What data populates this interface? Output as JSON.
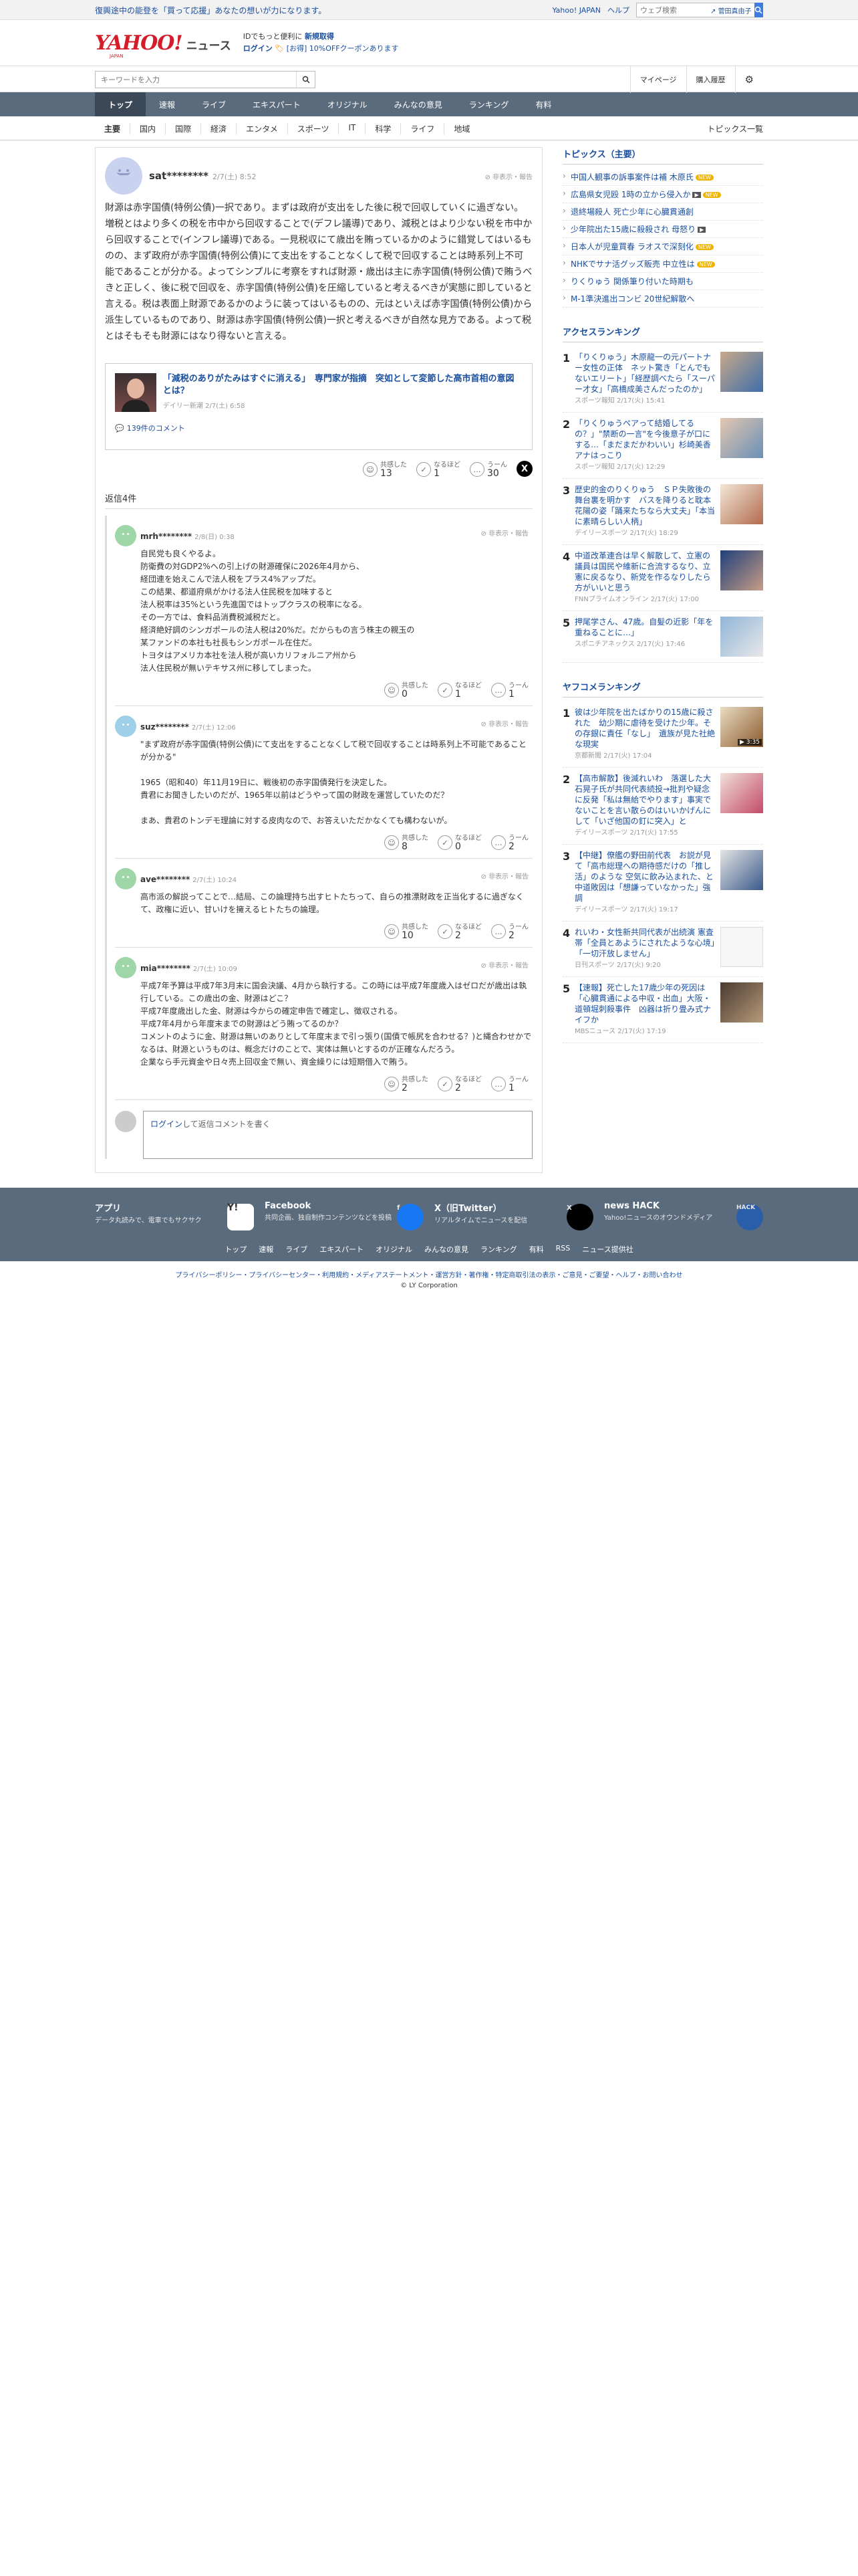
{
  "topbar": {
    "promo": "復興途中の能登を「買って応援」あなたの想いが力になります。",
    "yahoo_japan": "Yahoo! JAPAN",
    "help": "ヘルプ",
    "search_placeholder": "ウェブ検索",
    "trend": "菅田真由子"
  },
  "header": {
    "logo": "YAHOO!",
    "logo_sub": "JAPAN",
    "news": "ニュース",
    "promo_line1": "IDでもっと便利に",
    "promo_line1_b": "新規取得",
    "login": "ログイン",
    "promo_line2": "[お得] 10%OFFクーポンあります"
  },
  "searchbar": {
    "placeholder": "キーワードを入力",
    "mypage": "マイページ",
    "history": "購入履歴"
  },
  "mainnav": [
    "トップ",
    "速報",
    "ライブ",
    "エキスパート",
    "オリジナル",
    "みんなの意見",
    "ランキング",
    "有料"
  ],
  "subnav": {
    "items": [
      "主要",
      "国内",
      "国際",
      "経済",
      "エンタメ",
      "スポーツ",
      "IT",
      "科学",
      "ライフ",
      "地域"
    ],
    "all": "トピックス一覧"
  },
  "comment": {
    "user": "sat********",
    "time": "2/7(土) 8:52",
    "hide": "非表示・報告",
    "body": "財源は赤字国債(特例公債)一択であり。まずは政府が支出をした後に税で回収していくに過ぎない。増税とはより多くの税を市中から回収することで(デフレ議導)であり、減税とはより少ない税を市中から回収することで(インフレ議導)である。一見税収にて歳出を賄っているかのように錯覚してはいるものの、まず政府が赤字国債(特例公債)にて支出をすることなくして税で回収することは時系列上不可能であることが分かる。よってシンプルに考察をすれば財源・歳出は主に赤字国債(特例公債)で賄うべきと正しく、後に税で回収を、赤字国債(特例公債)を圧縮していると考えるべきが実態に即していると言える。税は表面上財源であるかのように装ってはいるものの、元はといえば赤字国債(特例公債)から派生しているものであり、財源は赤字国債(特例公債)一択と考えるべきが自然な見方である。よって税とはそもそも財源にはなり得ないと言える。",
    "article_title": "「減税のありがたみはすぐに消える」　専門家が指摘　突如として変節した高市首相の意図とは？",
    "article_src": "デイリー新潮 2/7(土) 6:58",
    "article_comments": "139件のコメント",
    "reacts": {
      "empathy": "共感した",
      "empathy_n": "13",
      "naruhodo": "なるほど",
      "naruhodo_n": "1",
      "uun": "うーん",
      "uun_n": "30"
    },
    "x_label": "X"
  },
  "replies_header": "返信4件",
  "replies": [
    {
      "user": "mrh********",
      "time": "2/8(日) 0:38",
      "color": "green",
      "body": "自民党も良くやるよ。\n防衛費の対GDP2%への引上げの財源確保に2026年4月から、\n経団連を始えこんで法人税をプラス4%アップだ。\nこの結果、都道府県がかける法人住民税を加味すると\n法人税率は35%という先進国ではトップクラスの税率になる。\nその一方では、食料品消費税減税だと。\n経済絶好調のシンガポールの法人税は20%だ。だからもの言う株主の親玉の\n某ファンドの本社も社長もシンガポール在住だ。\nトヨタはアメリカ本社を法人税が高いカリフォルニア州から\n法人住民税が無いテキサス州に移してしまった。",
      "r1": "0",
      "r2": "1",
      "r3": "1"
    },
    {
      "user": "suz********",
      "time": "2/7(土) 12:06",
      "color": "blue",
      "body": "\"まず政府が赤字国債(特例公債)にて支出をすることなくして税で回収することは時系列上不可能であることが分かる\"\n\n1965（昭和40）年11月19日に、戦後初の赤字国債発行を決定した。\n貴君にお聞きしたいのだが、1965年以前はどうやって国の財政を運営していたのだ？\n\nまあ、貴君のトンデモ理論に対する皮肉なので、お答えいただかなくても構わないが。",
      "r1": "8",
      "r2": "0",
      "r3": "2"
    },
    {
      "user": "ave********",
      "time": "2/7(土) 10:24",
      "color": "green",
      "body": "高市派の解説ってことで…結局、この論理持ち出すヒトたちって、自らの推漂財政を正当化するに過ぎなくて、政権に近い、甘いけを擁えるヒトたちの論理。",
      "r1": "10",
      "r2": "2",
      "r3": "2"
    },
    {
      "user": "mia********",
      "time": "2/7(土) 10:09",
      "color": "green",
      "body": "平成7年予算は平成7年3月末に国会決議、4月から執行する。この時には平成7年度歳入はゼロだが歳出は執行している。この歳出の金、財源はどこ？\n平成7年度歳出した金、財源は今からの確定申告で確定し、徴収される。\n平成7年4月から年度末までの財源はどう賄ってるのか？\nコメントのように金、財源は無いのありとして年度末まで引っ張り(国債で帳尻を合わせる？)と縄合わせかでなるは、財源というものは、概念だけのことで、実体は無いとするのが正確なんだろう。\n企業なら手元資金や日々売上回収金で無い、資金繰りには短期借入で賄う。",
      "r1": "2",
      "r2": "2",
      "r3": "1"
    }
  ],
  "reply_form": {
    "login": "ログイン",
    "text": "して返信コメントを書く"
  },
  "side": {
    "topics_title": "トピックス（主要）",
    "topics": [
      {
        "t": "中国人観事の訴事案件は補 木原氏",
        "badge": "NEW"
      },
      {
        "t": "広島県女児殴 1時の立から侵入か",
        "badge": "NEW",
        "video": true
      },
      {
        "t": "退終場殺人 死亡少年に心臓貫通創",
        "badge": ""
      },
      {
        "t": "少年院出た15歳に殺殺され 母怒り",
        "badge": "",
        "video": true
      },
      {
        "t": "日本人が児童買春 ラオスで深刻化",
        "badge": "NEW"
      },
      {
        "t": "NHKでサナ活グッズ販売 中立性は",
        "badge": "NEW"
      },
      {
        "t": "りくりゅう 関係筆り付いた時期も",
        "badge": ""
      },
      {
        "t": "M-1準決進出コンビ 20世紀解散へ",
        "badge": ""
      }
    ],
    "access_title": "アクセスランキング",
    "access": [
      {
        "n": "1",
        "t": "「りくりゅう」木原龍一の元パートナー女性の正体　ネット驚き「とんでもないエリート」「経歴調べたら「スーパー才女」「高橋成美さんだったのか」",
        "src": "スポーツ報知 2/17(火) 15:41",
        "th": "th1"
      },
      {
        "n": "2",
        "t": "「りくりゅうペアって結婚してるの？」\"禁断の一言\"を今後意子が口にする…「まだまだかわいい」杉崎美香アナはっこり",
        "src": "スポーツ報知 2/17(火) 12:29",
        "th": "th2"
      },
      {
        "n": "3",
        "t": "歴史的金のりくりゅう　ＳＰ失敗後の舞台裏を明かす　バスを降りると耽本花陽の姿「踊来たちなら大丈夫」「本当に素晴らしい人柄」",
        "src": "デイリースポーツ 2/17(火) 18:29",
        "th": "th3"
      },
      {
        "n": "4",
        "t": "中道改革連合は早く解散して、立憲の議員は国民や維新に合流するなり、立憲に戻るなり、新党を作るなりしたら方がいいと思う",
        "src": "FNNプライムオンライン 2/17(火) 17:00",
        "th": "th4"
      },
      {
        "n": "5",
        "t": "押尾学さん、47歳。自髪の近影「年を重ねることに…」",
        "src": "スポニチアネックス 2/17(火) 17:46",
        "th": "th5"
      }
    ],
    "comment_title": "ヤフコメランキング",
    "comment_rank": [
      {
        "n": "1",
        "t": "彼は少年院を出たばかりの15歳に殺された　幼少期に虐待を受けた少年。その存銀に責任「なし」　遺族が見た社絶な現実",
        "src": "京都新聞 2/17(火) 17:04",
        "th": "th6",
        "dur": "3:35"
      },
      {
        "n": "2",
        "t": "【高市解散】後減れいわ　落選した大石晃子氏が共同代表続投→批判や疑念に反発「私は無給でやります」事実でないことを言い散らのはいいかげんにして「いざ他国の釘に突入」と",
        "src": "デイリースポーツ 2/17(火) 17:55",
        "th": "th7",
        "dur": ""
      },
      {
        "n": "3",
        "t": "【中継】僚艦の野田前代表　お説が見て「高市総理への期待感だけの「推し活」のような 空気に飲み込まれた、と 中道敗因は「想謙っていなかった」強調",
        "src": "デイリースポーツ 2/17(火) 19:17",
        "th": "th8",
        "dur": ""
      },
      {
        "n": "4",
        "t": "れいわ・女性新共同代表が出続演 憲査帯「全員とあようにされたような心境」「一切汗放しません」",
        "src": "日刊スポーツ 2/17(火) 9:20",
        "th": "th9",
        "dur": ""
      },
      {
        "n": "5",
        "t": "【速報】死亡した17歳少年の死因は「心臓貫通による中収・出血」大阪・道頓堀刺殺事件　凶器は折り畳み式ナイフか",
        "src": "MBSニュース 2/17(火) 17:19",
        "th": "th10",
        "dur": ""
      }
    ]
  },
  "footer": {
    "boxes": [
      {
        "title": "アプリ",
        "desc": "データ丸読みで、電車でもサクサク",
        "icon": "Y!"
      },
      {
        "title": "Facebook",
        "desc": "共同企画、独自制作コンテンツなどを投稿",
        "icon": "f"
      },
      {
        "title": "X（旧Twitter）",
        "desc": "リアルタイムでニュースを配信",
        "icon": "X"
      },
      {
        "title": "news HACK",
        "desc": "Yahoo!ニュースのオウンドメディア",
        "icon": "HACK"
      }
    ],
    "links": [
      "トップ",
      "速報",
      "ライブ",
      "エキスパート",
      "オリジナル",
      "みんなの意見",
      "ランキング",
      "有料",
      "RSS",
      "ニュース提供社"
    ],
    "legal": "プライバシーポリシー・プライバシーセンター・利用規約・メディアステートメント・運営方針・著作権・特定商取引法の表示・ご意見・ご要望・ヘルプ・お問い合わせ",
    "copyright": "© LY Corporation"
  }
}
